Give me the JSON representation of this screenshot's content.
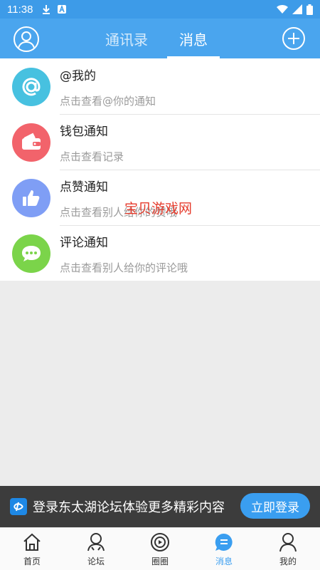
{
  "status_bar": {
    "time": "11:38"
  },
  "header": {
    "tabs": [
      {
        "label": "通讯录",
        "active": false
      },
      {
        "label": "消息",
        "active": true
      }
    ]
  },
  "messages": [
    {
      "title": "@我的",
      "subtitle": "点击查看@你的通知",
      "icon": "at-icon",
      "color": "#47c1e0"
    },
    {
      "title": "钱包通知",
      "subtitle": "点击查看记录",
      "icon": "wallet-icon",
      "color": "#f2636b"
    },
    {
      "title": "点赞通知",
      "subtitle": "点击查看别人给你的赞哦",
      "icon": "thumbs-up-icon",
      "color": "#7f9ef5"
    },
    {
      "title": "评论通知",
      "subtitle": "点击查看别人给你的评论哦",
      "icon": "comment-icon",
      "color": "#7bd44a"
    }
  ],
  "watermark": "宝贝游戏网",
  "login_banner": {
    "text": "登录东太湖论坛体验更多精彩内容",
    "button": "立即登录"
  },
  "bottom_nav": [
    {
      "label": "首页",
      "icon": "home-icon",
      "active": false
    },
    {
      "label": "论坛",
      "icon": "forum-icon",
      "active": false
    },
    {
      "label": "圈圈",
      "icon": "circle-icon",
      "active": false
    },
    {
      "label": "消息",
      "icon": "message-icon",
      "active": true
    },
    {
      "label": "我的",
      "icon": "profile-icon",
      "active": false
    }
  ],
  "colors": {
    "primary": "#4aa5ee",
    "accent": "#3a9ef0",
    "banner_bg": "#3c3c3c"
  }
}
